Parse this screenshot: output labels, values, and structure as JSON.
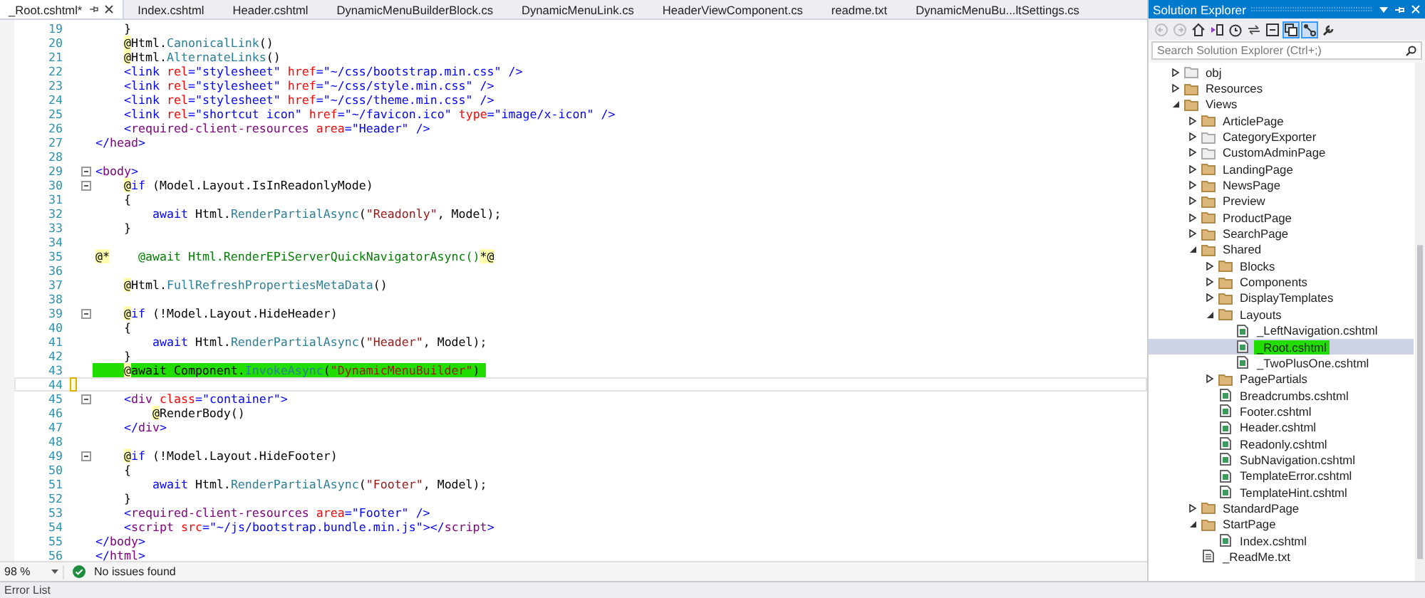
{
  "editor": {
    "tabs": [
      {
        "label": "_Root.cshtml*",
        "selected": true
      },
      {
        "label": "Index.cshtml",
        "selected": false
      },
      {
        "label": "Header.cshtml",
        "selected": false
      },
      {
        "label": "DynamicMenuBuilderBlock.cs",
        "selected": false
      },
      {
        "label": "DynamicMenuLink.cs",
        "selected": false
      },
      {
        "label": "HeaderViewComponent.cs",
        "selected": false
      },
      {
        "label": "readme.txt",
        "selected": false
      },
      {
        "label": "DynamicMenuBu...ltSettings.cs",
        "selected": false
      }
    ],
    "lines": [
      {
        "n": "19",
        "tokens": [
          {
            "kind": "plain",
            "text": "    }"
          }
        ],
        "foldable": false,
        "highlighted": false,
        "current": false,
        "changed": false
      },
      {
        "n": "20",
        "tokens": [
          {
            "kind": "razor",
            "text": "    @"
          },
          {
            "kind": "plain",
            "text": "Html."
          },
          {
            "kind": "method",
            "text": "CanonicalLink"
          },
          {
            "kind": "plain",
            "text": "()"
          }
        ],
        "foldable": false,
        "highlighted": false,
        "current": false,
        "changed": false
      },
      {
        "n": "21",
        "tokens": [
          {
            "kind": "razor",
            "text": "    @"
          },
          {
            "kind": "plain",
            "text": "Html."
          },
          {
            "kind": "method",
            "text": "AlternateLinks"
          },
          {
            "kind": "plain",
            "text": "()"
          }
        ],
        "foldable": false,
        "highlighted": false,
        "current": false,
        "changed": false
      },
      {
        "n": "22",
        "tokens": [
          {
            "kind": "tag",
            "text": "    <link "
          },
          {
            "kind": "attribute",
            "text": "rel"
          },
          {
            "kind": "tag",
            "text": "="
          },
          {
            "kind": "value",
            "text": "\"stylesheet\" "
          },
          {
            "kind": "attribute",
            "text": "href"
          },
          {
            "kind": "tag",
            "text": "="
          },
          {
            "kind": "value",
            "text": "\"~/css/bootstrap.min.css\" "
          },
          {
            "kind": "tag",
            "text": "/>"
          }
        ],
        "foldable": false,
        "highlighted": false,
        "current": false,
        "changed": false
      },
      {
        "n": "23",
        "tokens": [
          {
            "kind": "tag",
            "text": "    <link "
          },
          {
            "kind": "attribute",
            "text": "rel"
          },
          {
            "kind": "tag",
            "text": "="
          },
          {
            "kind": "value",
            "text": "\"stylesheet\" "
          },
          {
            "kind": "attribute",
            "text": "href"
          },
          {
            "kind": "tag",
            "text": "="
          },
          {
            "kind": "value",
            "text": "\"~/css/style.min.css\" "
          },
          {
            "kind": "tag",
            "text": "/>"
          }
        ],
        "foldable": false,
        "highlighted": false,
        "current": false,
        "changed": false
      },
      {
        "n": "24",
        "tokens": [
          {
            "kind": "tag",
            "text": "    <link "
          },
          {
            "kind": "attribute",
            "text": "rel"
          },
          {
            "kind": "tag",
            "text": "="
          },
          {
            "kind": "value",
            "text": "\"stylesheet\" "
          },
          {
            "kind": "attribute",
            "text": "href"
          },
          {
            "kind": "tag",
            "text": "="
          },
          {
            "kind": "value",
            "text": "\"~/css/theme.min.css\" "
          },
          {
            "kind": "tag",
            "text": "/>"
          }
        ],
        "foldable": false,
        "highlighted": false,
        "current": false,
        "changed": false
      },
      {
        "n": "25",
        "tokens": [
          {
            "kind": "tag",
            "text": "    <link "
          },
          {
            "kind": "attribute",
            "text": "rel"
          },
          {
            "kind": "tag",
            "text": "="
          },
          {
            "kind": "value",
            "text": "\"shortcut icon\" "
          },
          {
            "kind": "attribute",
            "text": "href"
          },
          {
            "kind": "tag",
            "text": "="
          },
          {
            "kind": "value",
            "text": "\"~/favicon.ico\" "
          },
          {
            "kind": "attribute",
            "text": "type"
          },
          {
            "kind": "tag",
            "text": "="
          },
          {
            "kind": "value",
            "text": "\"image/x-icon\" "
          },
          {
            "kind": "tag",
            "text": "/>"
          }
        ],
        "foldable": false,
        "highlighted": false,
        "current": false,
        "changed": false
      },
      {
        "n": "26",
        "tokens": [
          {
            "kind": "tag",
            "text": "    <"
          },
          {
            "kind": "element",
            "text": "required-client-resources "
          },
          {
            "kind": "attribute",
            "text": "area"
          },
          {
            "kind": "tag",
            "text": "="
          },
          {
            "kind": "value",
            "text": "\"Header\" "
          },
          {
            "kind": "tag",
            "text": "/>"
          }
        ],
        "foldable": false,
        "highlighted": false,
        "current": false,
        "changed": false
      },
      {
        "n": "27",
        "tokens": [
          {
            "kind": "tag",
            "text": "</"
          },
          {
            "kind": "element",
            "text": "head"
          },
          {
            "kind": "tag",
            "text": ">"
          }
        ],
        "foldable": false,
        "highlighted": false,
        "current": false,
        "changed": false
      },
      {
        "n": "28",
        "foldable": false,
        "highlighted": false,
        "current": false,
        "changed": false
      },
      {
        "n": "29",
        "tokens": [
          {
            "kind": "tag",
            "text": "<"
          },
          {
            "kind": "element",
            "text": "body"
          },
          {
            "kind": "tag",
            "text": ">"
          }
        ],
        "foldable": true,
        "highlighted": false,
        "current": false,
        "changed": false
      },
      {
        "n": "30",
        "tokens": [
          {
            "kind": "razor",
            "text": "    @"
          },
          {
            "kind": "keyword",
            "text": "if"
          },
          {
            "kind": "plain",
            "text": " (Model.Layout.IsInReadonlyMode)"
          }
        ],
        "foldable": true,
        "highlighted": false,
        "current": false,
        "changed": false
      },
      {
        "n": "31",
        "tokens": [
          {
            "kind": "plain",
            "text": "    {"
          }
        ],
        "foldable": false,
        "highlighted": false,
        "current": false,
        "changed": false
      },
      {
        "n": "32",
        "tokens": [
          {
            "kind": "keyword",
            "text": "        await"
          },
          {
            "kind": "plain",
            "text": " Html."
          },
          {
            "kind": "method",
            "text": "RenderPartialAsync"
          },
          {
            "kind": "plain",
            "text": "("
          },
          {
            "kind": "string",
            "text": "\"Readonly\""
          },
          {
            "kind": "plain",
            "text": ", Model);"
          }
        ],
        "foldable": false,
        "highlighted": false,
        "current": false,
        "changed": false
      },
      {
        "n": "33",
        "tokens": [
          {
            "kind": "plain",
            "text": "    }"
          }
        ],
        "foldable": false,
        "highlighted": false,
        "current": false,
        "changed": false
      },
      {
        "n": "34",
        "foldable": false,
        "highlighted": false,
        "current": false,
        "changed": false
      },
      {
        "n": "35",
        "tokens": [
          {
            "kind": "razor",
            "text": "@*"
          },
          {
            "kind": "comment",
            "text": "    @await Html.RenderEPiServerQuickNavigatorAsync()"
          },
          {
            "kind": "razor",
            "text": "*@"
          }
        ],
        "foldable": false,
        "highlighted": false,
        "current": false,
        "changed": false
      },
      {
        "n": "36",
        "foldable": false,
        "highlighted": false,
        "current": false,
        "changed": false
      },
      {
        "n": "37",
        "tokens": [
          {
            "kind": "razor",
            "text": "    @"
          },
          {
            "kind": "plain",
            "text": "Html."
          },
          {
            "kind": "method",
            "text": "FullRefreshPropertiesMetaData"
          },
          {
            "kind": "plain",
            "text": "()"
          }
        ],
        "foldable": false,
        "highlighted": false,
        "current": false,
        "changed": false
      },
      {
        "n": "38",
        "foldable": false,
        "highlighted": false,
        "current": false,
        "changed": false
      },
      {
        "n": "39",
        "tokens": [
          {
            "kind": "razor",
            "text": "    @"
          },
          {
            "kind": "keyword",
            "text": "if"
          },
          {
            "kind": "plain",
            "text": " (!Model.Layout.HideHeader)"
          }
        ],
        "foldable": true,
        "highlighted": false,
        "current": false,
        "changed": false
      },
      {
        "n": "40",
        "tokens": [
          {
            "kind": "plain",
            "text": "    {"
          }
        ],
        "foldable": false,
        "highlighted": false,
        "current": false,
        "changed": false
      },
      {
        "n": "41",
        "tokens": [
          {
            "kind": "keyword",
            "text": "        await"
          },
          {
            "kind": "plain",
            "text": " Html."
          },
          {
            "kind": "method",
            "text": "RenderPartialAsync"
          },
          {
            "kind": "plain",
            "text": "("
          },
          {
            "kind": "string",
            "text": "\"Header\""
          },
          {
            "kind": "plain",
            "text": ", Model);"
          }
        ],
        "foldable": false,
        "highlighted": false,
        "current": false,
        "changed": false
      },
      {
        "n": "42",
        "tokens": [
          {
            "kind": "plain",
            "text": "    }"
          }
        ],
        "foldable": false,
        "highlighted": false,
        "current": false,
        "changed": false
      },
      {
        "n": "43",
        "tokens": [
          {
            "kind": "razor",
            "text": "    @"
          },
          {
            "kind": "plain",
            "text": "await Component."
          },
          {
            "kind": "method",
            "text": "InvokeAsync"
          },
          {
            "kind": "plain",
            "text": "("
          },
          {
            "kind": "string",
            "text": "\"DynamicMenuBuilder\""
          },
          {
            "kind": "plain",
            "text": ")"
          }
        ],
        "foldable": false,
        "highlighted": true,
        "current": false,
        "changed": false
      },
      {
        "n": "44",
        "foldable": false,
        "highlighted": false,
        "current": true,
        "changed": true
      },
      {
        "n": "45",
        "tokens": [
          {
            "kind": "tag",
            "text": "    <"
          },
          {
            "kind": "element",
            "text": "div"
          },
          {
            "kind": "attribute",
            "text": " class"
          },
          {
            "kind": "tag",
            "text": "="
          },
          {
            "kind": "value",
            "text": "\"container\""
          },
          {
            "kind": "tag",
            "text": ">"
          }
        ],
        "foldable": true,
        "highlighted": false,
        "current": false,
        "changed": false
      },
      {
        "n": "46",
        "tokens": [
          {
            "kind": "razor",
            "text": "        @"
          },
          {
            "kind": "plain",
            "text": "RenderBody()"
          }
        ],
        "foldable": false,
        "highlighted": false,
        "current": false,
        "changed": false
      },
      {
        "n": "47",
        "tokens": [
          {
            "kind": "tag",
            "text": "    </"
          },
          {
            "kind": "element",
            "text": "div"
          },
          {
            "kind": "tag",
            "text": ">"
          }
        ],
        "foldable": false,
        "highlighted": false,
        "current": false,
        "changed": false
      },
      {
        "n": "48",
        "foldable": false,
        "highlighted": false,
        "current": false,
        "changed": false
      },
      {
        "n": "49",
        "tokens": [
          {
            "kind": "razor",
            "text": "    @"
          },
          {
            "kind": "keyword",
            "text": "if"
          },
          {
            "kind": "plain",
            "text": " (!Model.Layout.HideFooter)"
          }
        ],
        "foldable": true,
        "highlighted": false,
        "current": false,
        "changed": false
      },
      {
        "n": "50",
        "tokens": [
          {
            "kind": "plain",
            "text": "    {"
          }
        ],
        "foldable": false,
        "highlighted": false,
        "current": false,
        "changed": false
      },
      {
        "n": "51",
        "tokens": [
          {
            "kind": "keyword",
            "text": "        await"
          },
          {
            "kind": "plain",
            "text": " Html."
          },
          {
            "kind": "method",
            "text": "RenderPartialAsync"
          },
          {
            "kind": "plain",
            "text": "("
          },
          {
            "kind": "string",
            "text": "\"Footer\""
          },
          {
            "kind": "plain",
            "text": ", Model);"
          }
        ],
        "foldable": false,
        "highlighted": false,
        "current": false,
        "changed": false
      },
      {
        "n": "52",
        "tokens": [
          {
            "kind": "plain",
            "text": "    }"
          }
        ],
        "foldable": false,
        "highlighted": false,
        "current": false,
        "changed": false
      },
      {
        "n": "53",
        "tokens": [
          {
            "kind": "tag",
            "text": "    <"
          },
          {
            "kind": "element",
            "text": "required-client-resources "
          },
          {
            "kind": "attribute",
            "text": "area"
          },
          {
            "kind": "tag",
            "text": "="
          },
          {
            "kind": "value",
            "text": "\"Footer\" "
          },
          {
            "kind": "tag",
            "text": "/>"
          }
        ],
        "foldable": false,
        "highlighted": false,
        "current": false,
        "changed": false
      },
      {
        "n": "54",
        "tokens": [
          {
            "kind": "tag",
            "text": "    <"
          },
          {
            "kind": "element",
            "text": "script"
          },
          {
            "kind": "attribute",
            "text": " src"
          },
          {
            "kind": "tag",
            "text": "="
          },
          {
            "kind": "value",
            "text": "\"~/js/bootstrap.bundle.min.js\""
          },
          {
            "kind": "tag",
            "text": "></"
          },
          {
            "kind": "element",
            "text": "script"
          },
          {
            "kind": "tag",
            "text": ">"
          }
        ],
        "foldable": false,
        "highlighted": false,
        "current": false,
        "changed": false
      },
      {
        "n": "55",
        "tokens": [
          {
            "kind": "tag",
            "text": "</"
          },
          {
            "kind": "element",
            "text": "body"
          },
          {
            "kind": "tag",
            "text": ">"
          }
        ],
        "foldable": false,
        "highlighted": false,
        "current": false,
        "changed": false
      },
      {
        "n": "56",
        "tokens": [
          {
            "kind": "tag",
            "text": "</"
          },
          {
            "kind": "element",
            "text": "html"
          },
          {
            "kind": "tag",
            "text": ">"
          }
        ],
        "foldable": false,
        "highlighted": false,
        "current": false,
        "changed": false
      }
    ],
    "zoom": "98 %",
    "status": "No issues found"
  },
  "solution_explorer": {
    "title": "Solution Explorer",
    "search": {
      "placeholder": "Search Solution Explorer (Ctrl+;)"
    },
    "tree": [
      {
        "label": "obj",
        "kind": "excluded",
        "expanded": false,
        "selected": false,
        "highlighted": false
      },
      {
        "label": "Resources",
        "kind": "folder",
        "expanded": false,
        "selected": false,
        "highlighted": false
      },
      {
        "label": "Views",
        "kind": "folder",
        "expanded": true,
        "selected": false,
        "highlighted": false,
        "children": [
          {
            "label": "ArticlePage",
            "kind": "folder",
            "expanded": false,
            "selected": false,
            "highlighted": false
          },
          {
            "label": "CategoryExporter",
            "kind": "excluded",
            "expanded": false,
            "selected": false,
            "highlighted": false
          },
          {
            "label": "CustomAdminPage",
            "kind": "excluded",
            "expanded": false,
            "selected": false,
            "highlighted": false
          },
          {
            "label": "LandingPage",
            "kind": "folder",
            "expanded": false,
            "selected": false,
            "highlighted": false
          },
          {
            "label": "NewsPage",
            "kind": "folder",
            "expanded": false,
            "selected": false,
            "highlighted": false
          },
          {
            "label": "Preview",
            "kind": "folder",
            "expanded": false,
            "selected": false,
            "highlighted": false
          },
          {
            "label": "ProductPage",
            "kind": "folder",
            "expanded": false,
            "selected": false,
            "highlighted": false
          },
          {
            "label": "SearchPage",
            "kind": "folder",
            "expanded": false,
            "selected": false,
            "highlighted": false
          },
          {
            "label": "Shared",
            "kind": "folder",
            "expanded": true,
            "selected": false,
            "highlighted": false,
            "children": [
              {
                "label": "Blocks",
                "kind": "folder",
                "expanded": false,
                "selected": false,
                "highlighted": false
              },
              {
                "label": "Components",
                "kind": "folder",
                "expanded": false,
                "selected": false,
                "highlighted": false
              },
              {
                "label": "DisplayTemplates",
                "kind": "folder",
                "expanded": false,
                "selected": false,
                "highlighted": false
              },
              {
                "label": "Layouts",
                "kind": "folder",
                "expanded": true,
                "selected": false,
                "highlighted": false,
                "children": [
                  {
                    "label": "_LeftNavigation.cshtml",
                    "kind": "razor",
                    "selected": false,
                    "highlighted": false
                  },
                  {
                    "label": "_Root.cshtml",
                    "kind": "razor",
                    "selected": true,
                    "highlighted": true
                  },
                  {
                    "label": "_TwoPlusOne.cshtml",
                    "kind": "razor",
                    "selected": false,
                    "highlighted": false
                  }
                ]
              },
              {
                "label": "PagePartials",
                "kind": "folder",
                "expanded": false,
                "selected": false,
                "highlighted": false
              },
              {
                "label": "Breadcrumbs.cshtml",
                "kind": "razor",
                "selected": false,
                "highlighted": false
              },
              {
                "label": "Footer.cshtml",
                "kind": "razor",
                "selected": false,
                "highlighted": false
              },
              {
                "label": "Header.cshtml",
                "kind": "razor",
                "selected": false,
                "highlighted": false
              },
              {
                "label": "Readonly.cshtml",
                "kind": "razor",
                "selected": false,
                "highlighted": false
              },
              {
                "label": "SubNavigation.cshtml",
                "kind": "razor",
                "selected": false,
                "highlighted": false
              },
              {
                "label": "TemplateError.cshtml",
                "kind": "razor",
                "selected": false,
                "highlighted": false
              },
              {
                "label": "TemplateHint.cshtml",
                "kind": "razor",
                "selected": false,
                "highlighted": false
              }
            ]
          },
          {
            "label": "StandardPage",
            "kind": "folder",
            "expanded": false,
            "selected": false,
            "highlighted": false
          },
          {
            "label": "StartPage",
            "kind": "folder",
            "expanded": true,
            "selected": false,
            "highlighted": false,
            "children": [
              {
                "label": "Index.cshtml",
                "kind": "razor",
                "selected": false,
                "highlighted": false
              }
            ]
          },
          {
            "label": "_ReadMe.txt",
            "kind": "text",
            "selected": false,
            "highlighted": false
          }
        ]
      }
    ]
  },
  "bottom_panel": {
    "tabs": [
      "Error List"
    ]
  }
}
